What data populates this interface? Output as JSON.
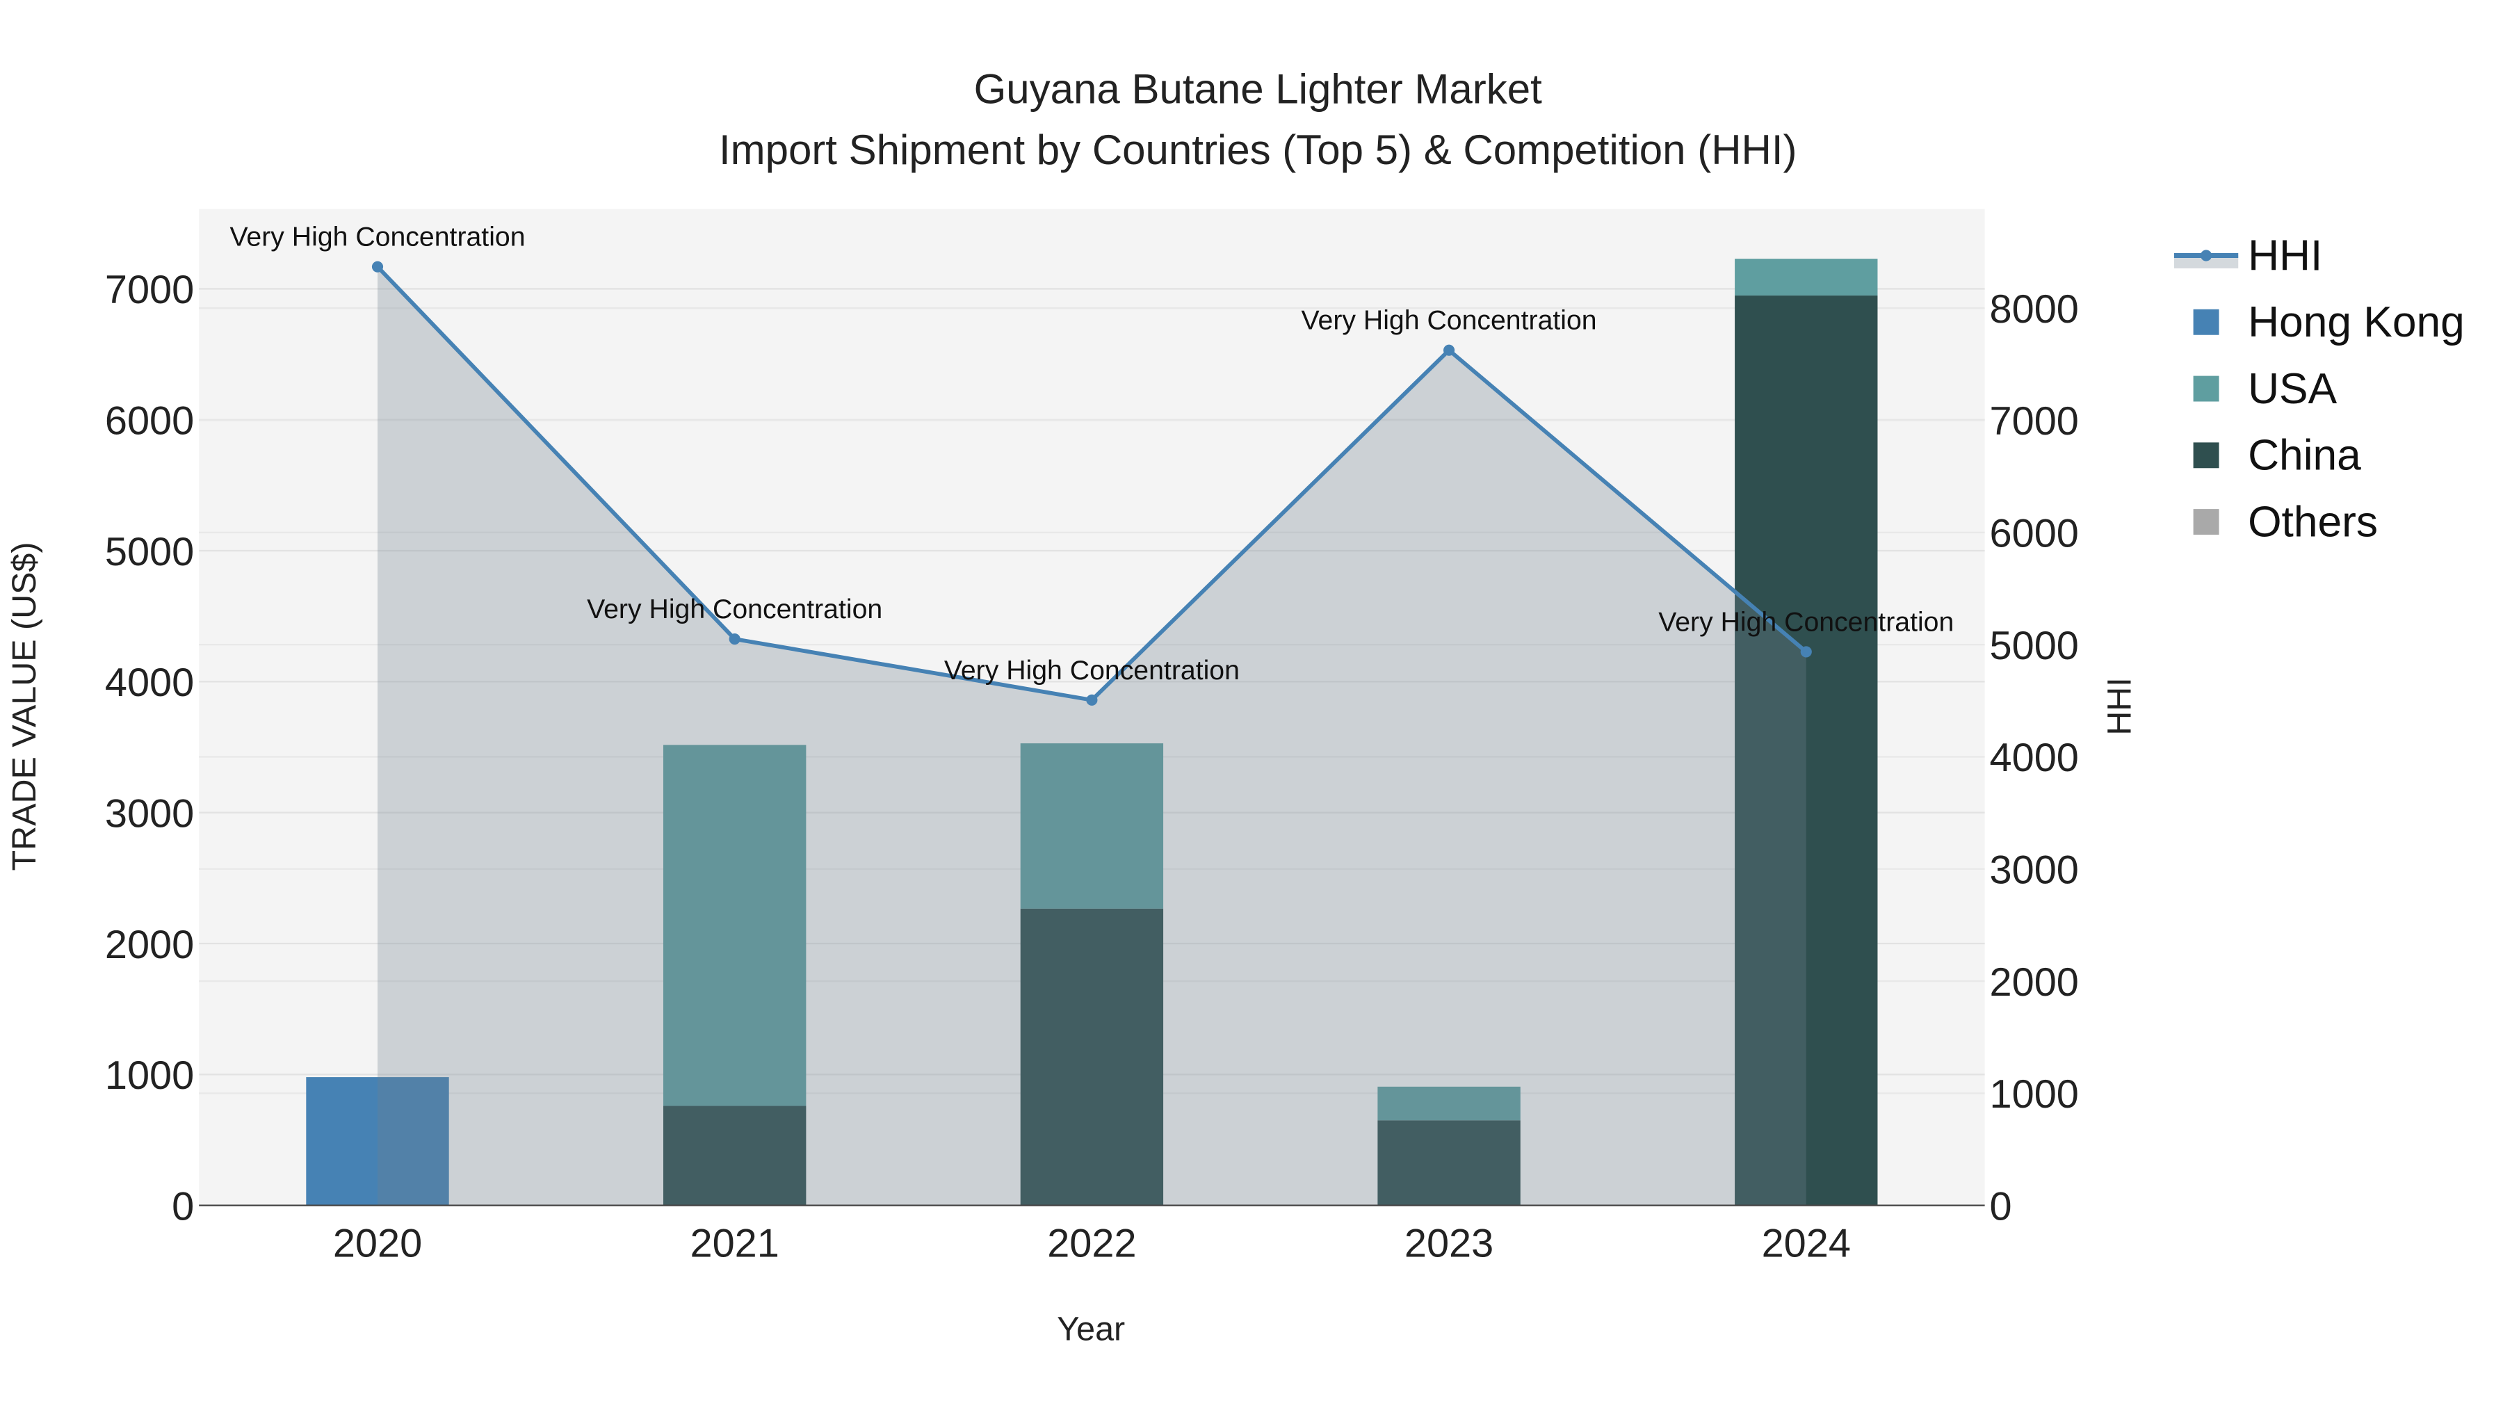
{
  "chart_data": {
    "type": "bar",
    "title": "Guyana Butane Lighter Market",
    "subtitle": "Import Shipment by Countries (Top 5) & Competition (HHI)",
    "xlabel": "Year",
    "ylabel": "TRADE VALUE (US$)",
    "y2label": "HHI",
    "categories": [
      "2020",
      "2021",
      "2022",
      "2023",
      "2024"
    ],
    "ylim": [
      0,
      7610
    ],
    "y2lim": [
      0,
      8884
    ],
    "yticks": [
      0,
      1000,
      2000,
      3000,
      4000,
      5000,
      6000,
      7000
    ],
    "y2ticks": [
      0,
      1000,
      2000,
      3000,
      4000,
      5000,
      6000,
      7000,
      8000
    ],
    "barmode": "stack",
    "series": [
      {
        "name": "Hong Kong",
        "color": "#4682b4",
        "values": [
          980,
          0,
          0,
          0,
          0
        ]
      },
      {
        "name": "China",
        "color": "#2f4f4f",
        "values": [
          0,
          760,
          2267,
          650,
          6949
        ]
      },
      {
        "name": "USA",
        "color": "#5f9ea0",
        "values": [
          0,
          2757,
          1262,
          257,
          281
        ]
      },
      {
        "name": "Others",
        "color": "#a9a9a9",
        "values": [
          0,
          0,
          0,
          0,
          0
        ]
      }
    ],
    "hhi": {
      "name": "HHI",
      "color": "#4682b4",
      "values": [
        8369,
        5050,
        4506,
        7625,
        4936
      ],
      "annotations": [
        "Very High Concentration",
        "Very High Concentration",
        "Very High Concentration",
        "Very High Concentration",
        "Very High Concentration"
      ]
    },
    "legend": [
      "HHI",
      "Hong Kong",
      "USA",
      "China",
      "Others"
    ],
    "legend_position": "top-right",
    "grid": true
  }
}
